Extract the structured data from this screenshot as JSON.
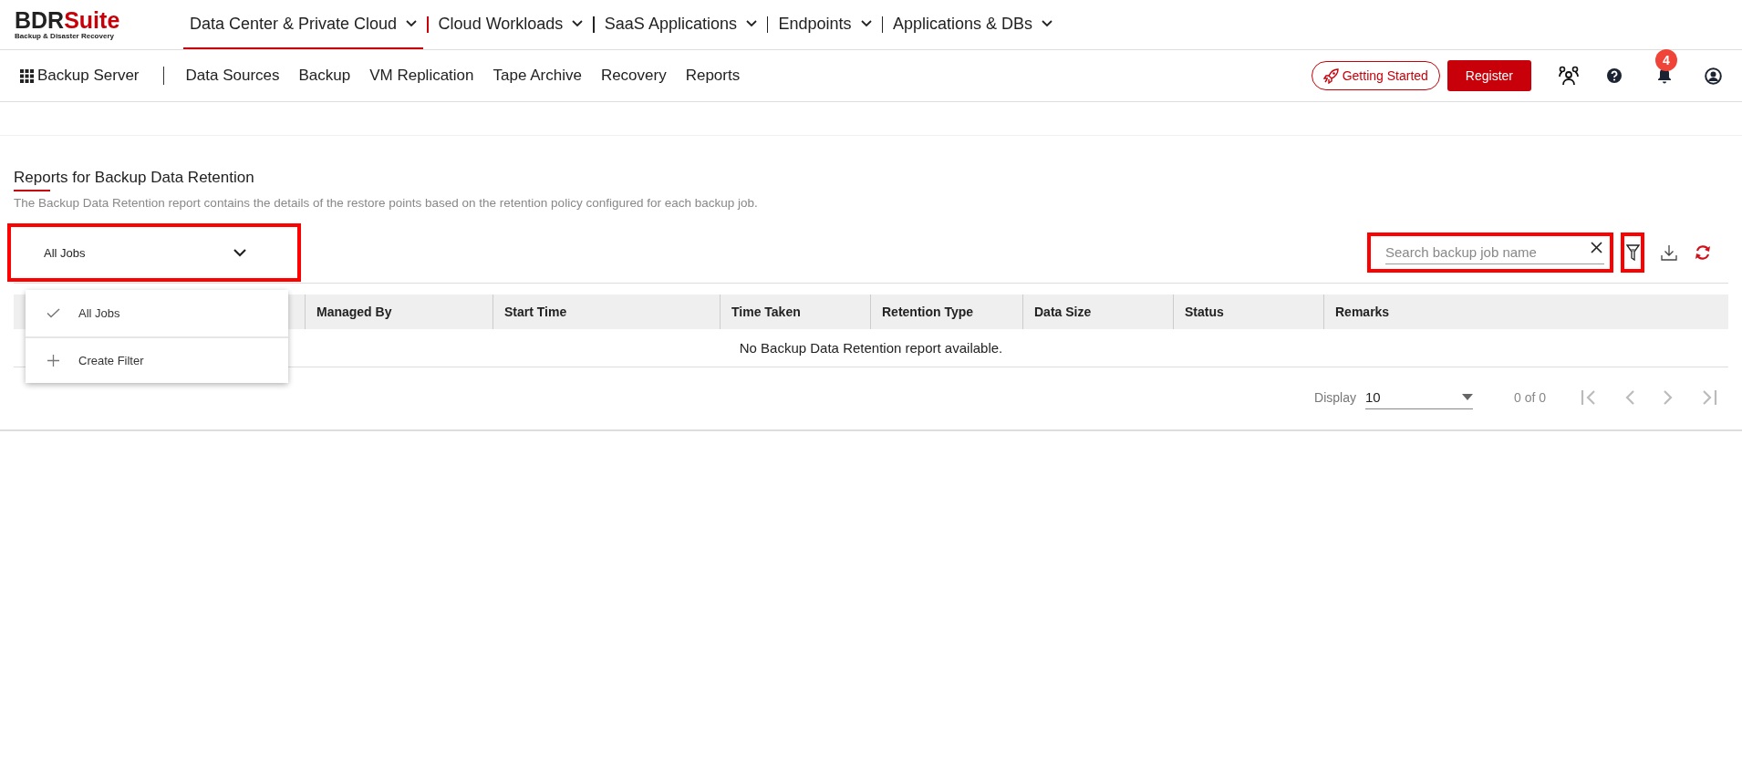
{
  "brand": {
    "name_dark": "BDR",
    "name_red": "Suite",
    "tagline": "Backup & Disaster Recovery"
  },
  "top_nav": [
    {
      "label": "Data Center & Private Cloud",
      "selected": true
    },
    {
      "label": "Cloud Workloads",
      "selected": false
    },
    {
      "label": "SaaS Applications",
      "selected": false
    },
    {
      "label": "Endpoints",
      "selected": false
    },
    {
      "label": "Applications & DBs",
      "selected": false
    }
  ],
  "sub_nav": {
    "product": "Backup Server",
    "items": [
      "Data Sources",
      "Backup",
      "VM Replication",
      "Tape Archive",
      "Recovery",
      "Reports"
    ]
  },
  "actions": {
    "getting_started": "Getting Started",
    "register": "Register",
    "notification_count": "4"
  },
  "page": {
    "title": "Reports for Backup Data Retention",
    "description": "The Backup Data Retention report contains the details of the restore points based on the retention policy configured for each backup job."
  },
  "job_filter": {
    "value": "All Jobs",
    "expanded": true,
    "options": [
      {
        "kind": "option",
        "label": "All Jobs",
        "selected": true
      },
      {
        "kind": "action",
        "label": "Create Filter",
        "selected": false
      }
    ]
  },
  "search": {
    "placeholder": "Search backup job name"
  },
  "table": {
    "columns": [
      "Managed By",
      "Start Time",
      "Time Taken",
      "Retention Type",
      "Data Size",
      "Status",
      "Remarks"
    ],
    "empty_message": "No Backup Data Retention report available."
  },
  "pagination": {
    "display_label": "Display",
    "page_size": "10",
    "range": "0 of 0"
  }
}
